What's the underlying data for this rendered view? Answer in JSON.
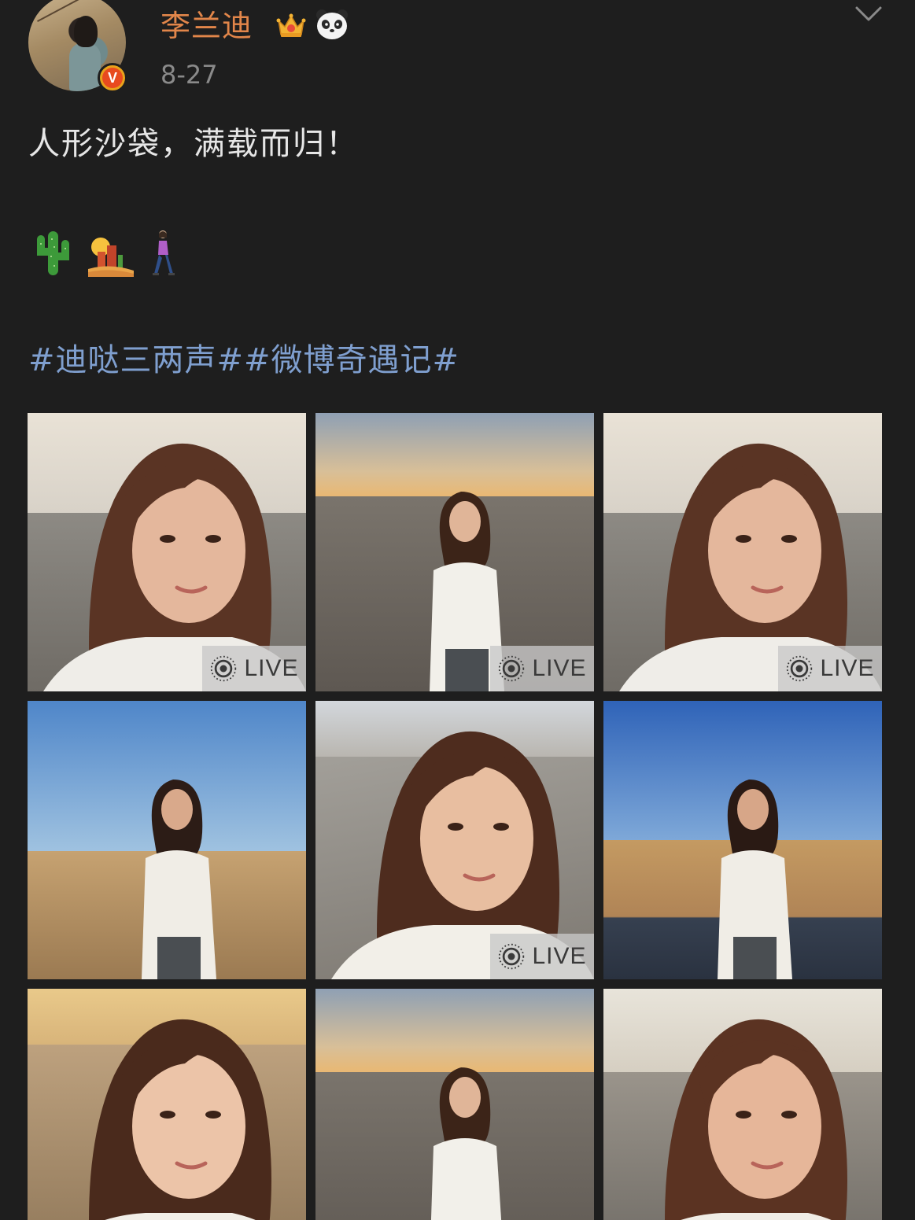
{
  "user": {
    "name": "李兰迪",
    "time": "8-27",
    "verified_label": "V"
  },
  "post": {
    "text": "人形沙袋，满载而归！",
    "emojis": [
      "cactus-icon",
      "desert-sunset-icon",
      "woman-walking-icon"
    ],
    "hashtags": "#迪哒三两声##微博奇遇记#"
  },
  "photos": [
    {
      "scene": "warm-selfie",
      "live": true
    },
    {
      "scene": "dune-walk",
      "live": true
    },
    {
      "scene": "warm-selfie",
      "live": true
    },
    {
      "scene": "blue-sky-dune",
      "live": false
    },
    {
      "scene": "slope-selfie",
      "live": true
    },
    {
      "scene": "road-dune",
      "live": false
    },
    {
      "scene": "closeup",
      "live": false
    },
    {
      "scene": "dune-walk",
      "live": false
    },
    {
      "scene": "sunset-selfie",
      "live": false
    }
  ],
  "live_label": "LIVE",
  "colors": {
    "background": "#1e1e1e",
    "username": "#e2864a",
    "hashtag": "#7f9fcf",
    "text": "#e6e6e6",
    "time": "#8a8a8a"
  }
}
